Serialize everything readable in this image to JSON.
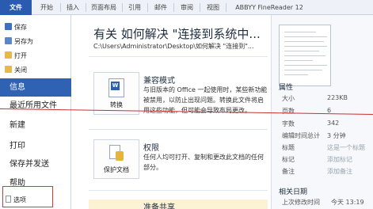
{
  "ribbon": {
    "tabs": [
      "文件",
      "开始",
      "插入",
      "页面布局",
      "引用",
      "邮件",
      "审阅",
      "视图",
      "ABBYY FineReader 12"
    ]
  },
  "nav": {
    "commands": [
      "保存",
      "另存为",
      "打开",
      "关闭"
    ],
    "items": [
      "信息",
      "最近所用文件",
      "新建",
      "打印",
      "保存并发送",
      "帮助"
    ],
    "options": "选项"
  },
  "main": {
    "title": "有关 如何解决 \"连接到系统中...",
    "path": "C:\\Users\\Administrator\\Desktop\\如何解决 \"连接到\"...",
    "sections": [
      {
        "button": "转换",
        "title": "兼容模式",
        "desc": "与旧版本的 Office 一起使用时，某些新功能被禁用，以防止出现问题。转换此文件将启用这些功能，但可能会导致布局更改。"
      },
      {
        "button": "保护文档",
        "title": "权限",
        "desc": "任何人均可打开、复制和更改此文档的任何部分。"
      },
      {
        "title": "准备共享"
      }
    ]
  },
  "properties": {
    "heading": "属性",
    "rows": [
      {
        "key": "大小",
        "value": "223KB"
      },
      {
        "key": "页数",
        "value": "6"
      },
      {
        "key": "字数",
        "value": "342"
      },
      {
        "key": "编辑时间总计",
        "value": "3 分钟"
      },
      {
        "key": "标题",
        "value": "这是一个标题"
      },
      {
        "key": "标记",
        "value": "添加标记"
      },
      {
        "key": "备注",
        "value": "添加备注"
      }
    ],
    "dates_heading": "相关日期",
    "date_rows": [
      {
        "key": "上次修改时间",
        "value": "今天 13:19"
      }
    ]
  },
  "colors": {
    "file_tab": "#2a5bb0",
    "selected_nav": "#2f62b3",
    "annotation_red": "#c63232"
  },
  "icons": [
    "save-icon",
    "save-as-icon",
    "open-folder-icon",
    "close-icon",
    "options-icon",
    "convert-icon",
    "protect-icon"
  ]
}
